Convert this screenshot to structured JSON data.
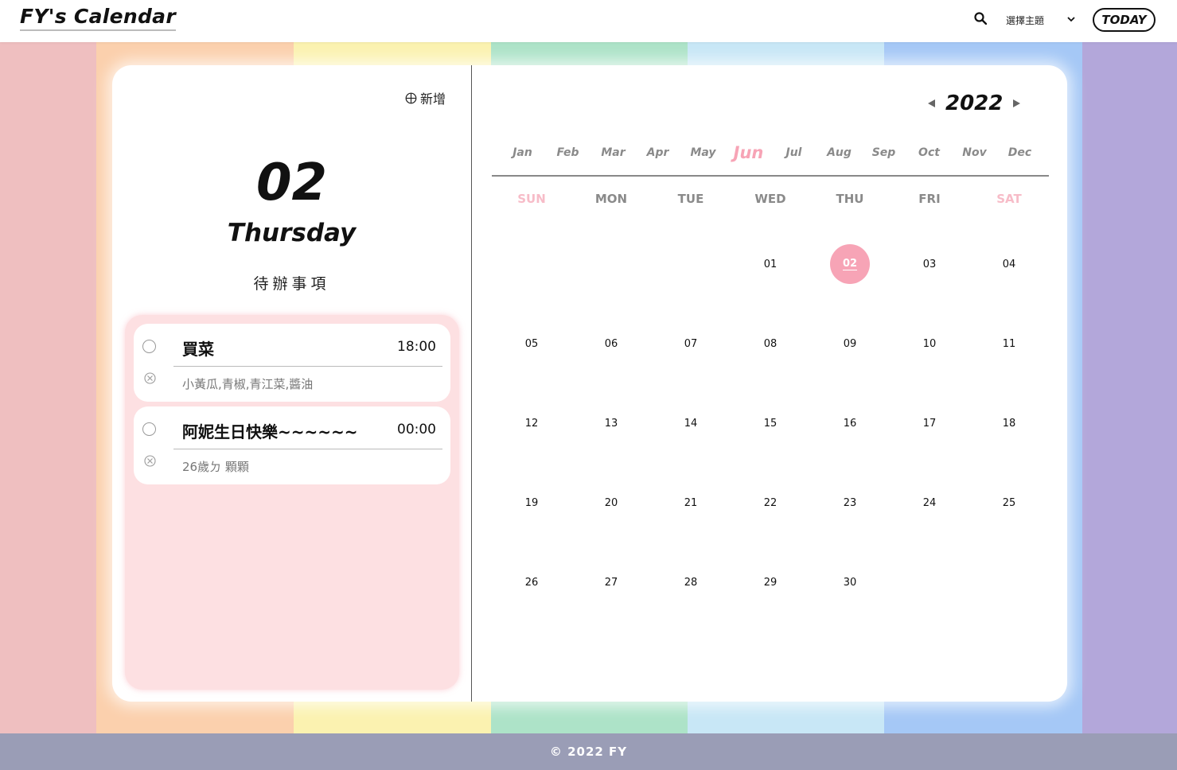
{
  "header": {
    "logo": "FY's Calendar",
    "theme_label": "選擇主題",
    "today_label": "TODAY"
  },
  "colors": {
    "stripes": [
      "#efbfc0",
      "#fbd0ad",
      "#fbf2b0",
      "#ade3c8",
      "#c8e7f6",
      "#a5c8f6",
      "#b3a7da"
    ],
    "accent": "#f7a4b6",
    "todo_panel": "#fde0e2",
    "footer": "#9a9db6"
  },
  "left": {
    "add_label": "新增",
    "date": "02",
    "weekday": "Thursday",
    "todo_title": "待辦事項",
    "todos": [
      {
        "name": "買菜",
        "time": "18:00",
        "note": "小黃瓜,青椒,青江菜,醬油"
      },
      {
        "name": "阿妮生日快樂~~~~~~",
        "time": "00:00",
        "note": "26歲ㄉ 顆顆"
      }
    ]
  },
  "calendar": {
    "year": "2022",
    "months": [
      "Jan",
      "Feb",
      "Mar",
      "Apr",
      "May",
      "Jun",
      "Jul",
      "Aug",
      "Sep",
      "Oct",
      "Nov",
      "Dec"
    ],
    "active_month": "Jun",
    "weekdays": [
      "SUN",
      "MON",
      "TUE",
      "WED",
      "THU",
      "FRI",
      "SAT"
    ],
    "first_weekday_index": 3,
    "days_in_month": 30,
    "selected_day": "02"
  },
  "footer": {
    "text": "© 2022 FY"
  }
}
